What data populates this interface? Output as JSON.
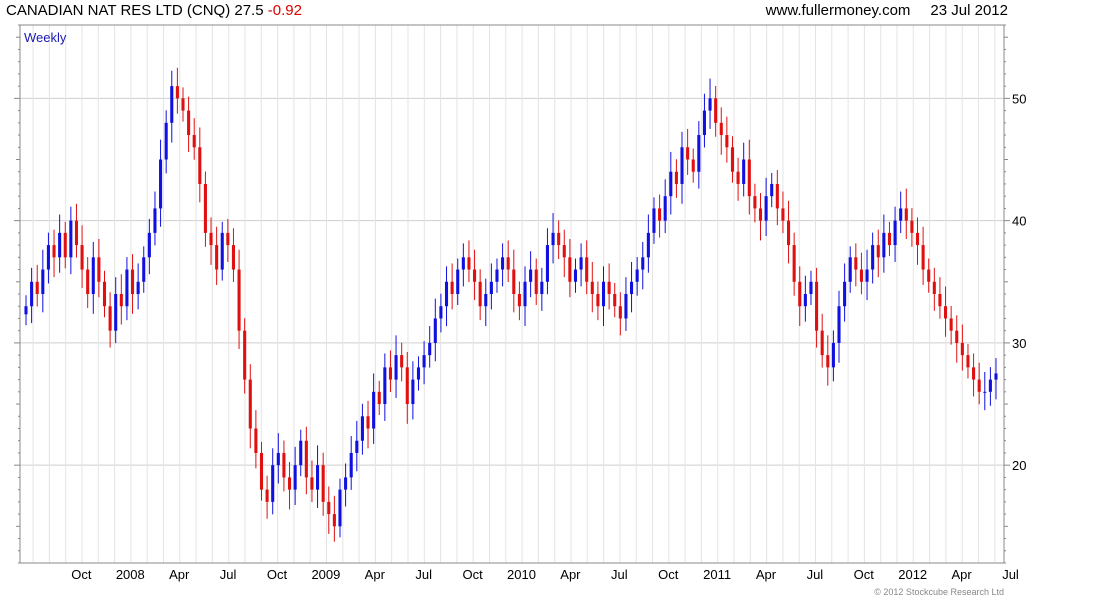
{
  "header": {
    "name": "CANADIAN NAT RES LTD (CNQ)",
    "last": "27.5",
    "change": "-0.92",
    "website": "www.fullermoney.com",
    "date": "23 Jul 2012"
  },
  "footer": {
    "copyright": "© 2012 Stockcube Research Ltd"
  },
  "colors": {
    "up": "#1010e0",
    "down": "#e01010",
    "grid": "#dcdcdc",
    "frame": "#888888"
  },
  "chart_data": {
    "type": "candlestick",
    "frequency_label": "Weekly",
    "x_tick_labels": [
      "Oct",
      "2008",
      "Apr",
      "Jul",
      "Oct",
      "2009",
      "Apr",
      "Jul",
      "Oct",
      "2010",
      "Apr",
      "Jul",
      "Oct",
      "2011",
      "Apr",
      "Jul",
      "Oct",
      "2012",
      "Apr",
      "Jul"
    ],
    "y_tick_labels": [
      "20",
      "30",
      "40",
      "50"
    ],
    "ylim": [
      12,
      56
    ],
    "grid": true,
    "y_axis_side": "right",
    "close_series": [
      33,
      35,
      34,
      36,
      38,
      37,
      39,
      37,
      40,
      38,
      36,
      34,
      37,
      35,
      33,
      31,
      34,
      33,
      36,
      34,
      35,
      37,
      39,
      41,
      45,
      48,
      51,
      50,
      49,
      47,
      46,
      43,
      39,
      38,
      36,
      39,
      38,
      36,
      31,
      27,
      23,
      21,
      18,
      17,
      20,
      21,
      19,
      18,
      20,
      22,
      19,
      18,
      20,
      17,
      16,
      15,
      18,
      19,
      21,
      22,
      24,
      23,
      26,
      25,
      28,
      27,
      29,
      28,
      25,
      27,
      28,
      29,
      30,
      32,
      33,
      35,
      34,
      36,
      37,
      36,
      35,
      33,
      34,
      35,
      36,
      37,
      36,
      34,
      33,
      35,
      36,
      34,
      35,
      38,
      39,
      38,
      37,
      35,
      36,
      37,
      35,
      34,
      33,
      35,
      34,
      33,
      32,
      34,
      35,
      36,
      37,
      39,
      41,
      40,
      42,
      44,
      43,
      46,
      45,
      44,
      47,
      49,
      50,
      48,
      47,
      46,
      44,
      43,
      45,
      42,
      41,
      40,
      42,
      43,
      41,
      40,
      38,
      35,
      33,
      34,
      35,
      31,
      29,
      28,
      30,
      33,
      35,
      37,
      36,
      35,
      36,
      38,
      37,
      39,
      38,
      40,
      41,
      40,
      39,
      38,
      36,
      35,
      34,
      33,
      32,
      31,
      30,
      29,
      28,
      27,
      26,
      26,
      27,
      27.5
    ]
  }
}
